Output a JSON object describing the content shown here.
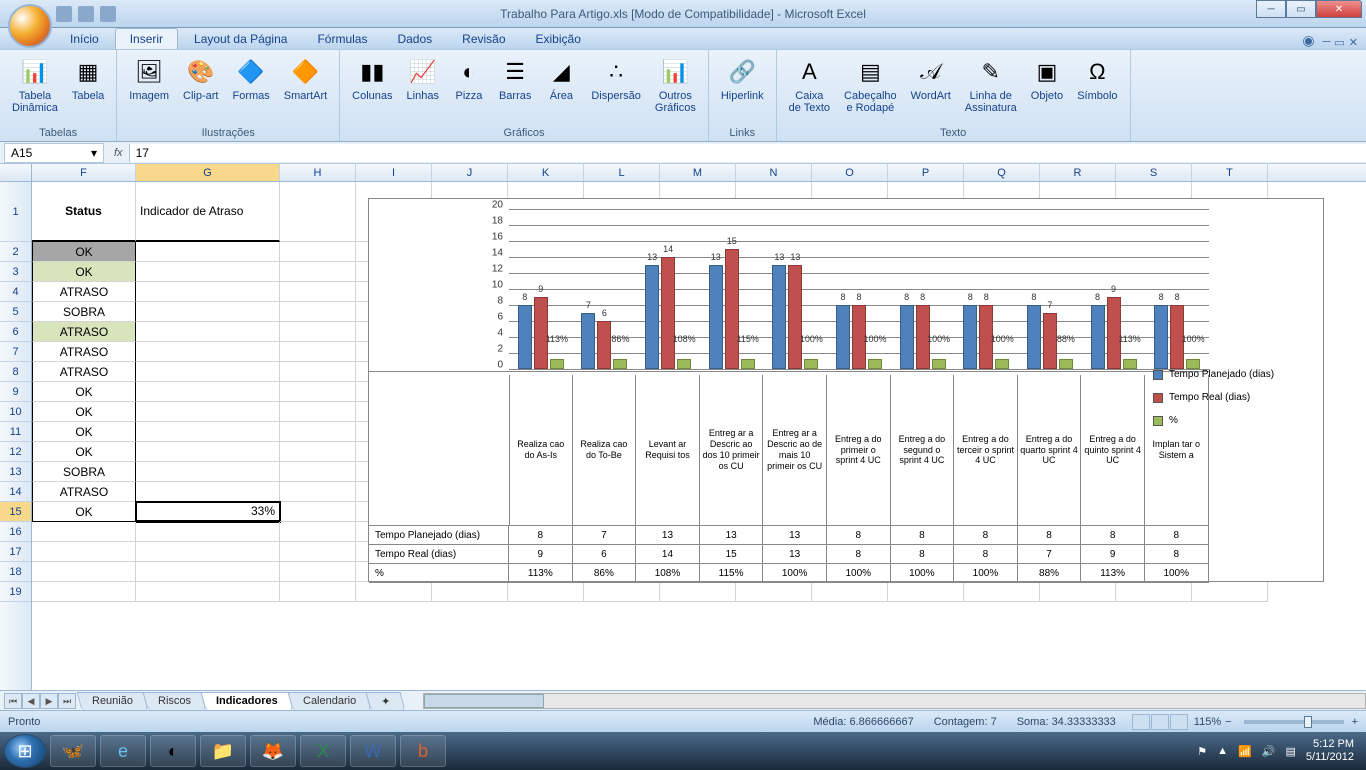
{
  "window": {
    "title": "Trabalho Para Artigo.xls  [Modo de Compatibilidade] - Microsoft Excel"
  },
  "tabs": {
    "items": [
      "Início",
      "Inserir",
      "Layout da Página",
      "Fórmulas",
      "Dados",
      "Revisão",
      "Exibição"
    ],
    "active": 1
  },
  "ribbon": {
    "groups": [
      {
        "title": "Tabelas",
        "items": [
          {
            "label": "Tabela\nDinâmica",
            "icon": "📊"
          },
          {
            "label": "Tabela",
            "icon": "▦"
          }
        ]
      },
      {
        "title": "Ilustrações",
        "items": [
          {
            "label": "Imagem",
            "icon": "🖼"
          },
          {
            "label": "Clip-art",
            "icon": "🎨"
          },
          {
            "label": "Formas",
            "icon": "🔷"
          },
          {
            "label": "SmartArt",
            "icon": "🔶"
          }
        ]
      },
      {
        "title": "Gráficos",
        "items": [
          {
            "label": "Colunas",
            "icon": "▮▮"
          },
          {
            "label": "Linhas",
            "icon": "📈"
          },
          {
            "label": "Pizza",
            "icon": "◐"
          },
          {
            "label": "Barras",
            "icon": "☰"
          },
          {
            "label": "Área",
            "icon": "◢"
          },
          {
            "label": "Dispersão",
            "icon": "∴"
          },
          {
            "label": "Outros\nGráficos",
            "icon": "📊"
          }
        ]
      },
      {
        "title": "Links",
        "items": [
          {
            "label": "Hiperlink",
            "icon": "🔗"
          }
        ]
      },
      {
        "title": "Texto",
        "items": [
          {
            "label": "Caixa\nde Texto",
            "icon": "A"
          },
          {
            "label": "Cabeçalho\ne Rodapé",
            "icon": "▤"
          },
          {
            "label": "WordArt",
            "icon": "𝒜"
          },
          {
            "label": "Linha de\nAssinatura",
            "icon": "✎"
          },
          {
            "label": "Objeto",
            "icon": "▣"
          },
          {
            "label": "Símbolo",
            "icon": "Ω"
          }
        ]
      }
    ]
  },
  "formula_bar": {
    "name_box": "A15",
    "formula": "17"
  },
  "columns": [
    "F",
    "G",
    "H",
    "I",
    "J",
    "K",
    "L",
    "M",
    "N",
    "O",
    "P",
    "Q",
    "R",
    "S",
    "T"
  ],
  "table": {
    "header": {
      "F": "Status",
      "G": "Indicador de Atraso"
    },
    "rows": [
      {
        "F": "OK",
        "class": "grey"
      },
      {
        "F": "OK",
        "class": "lightgreen"
      },
      {
        "F": "ATRASO",
        "class": ""
      },
      {
        "F": "SOBRA",
        "class": ""
      },
      {
        "F": "ATRASO",
        "class": "lightgreen"
      },
      {
        "F": "ATRASO",
        "class": ""
      },
      {
        "F": "ATRASO",
        "class": ""
      },
      {
        "F": "OK",
        "class": ""
      },
      {
        "F": "OK",
        "class": ""
      },
      {
        "F": "OK",
        "class": ""
      },
      {
        "F": "OK",
        "class": ""
      },
      {
        "F": "SOBRA",
        "class": ""
      },
      {
        "F": "ATRASO",
        "class": ""
      },
      {
        "F": "OK",
        "G": "33%",
        "class": ""
      }
    ]
  },
  "chart_data": {
    "type": "bar",
    "categories": [
      "Realiza cao do As-Is",
      "Realiza cao do To-Be",
      "Levant ar Requisi tos",
      "Entreg ar a Descric ao dos 10 primeir os CU",
      "Entreg ar a Descric ao de mais 10 primeir os CU",
      "Entreg a do primeir o sprint 4 UC",
      "Entreg a do segund o sprint 4 UC",
      "Entreg a do terceir o sprint 4 UC",
      "Entreg a do quarto sprint 4 UC",
      "Entreg a do quinto sprint 4 UC",
      "Implan tar o Sistem a"
    ],
    "series": [
      {
        "name": "Tempo Planejado (dias)",
        "color": "#4f81bd",
        "values": [
          8,
          7,
          13,
          13,
          13,
          8,
          8,
          8,
          8,
          8,
          8
        ]
      },
      {
        "name": "Tempo Real (dias)",
        "color": "#c0504d",
        "values": [
          9,
          6,
          14,
          15,
          13,
          8,
          8,
          8,
          7,
          9,
          8
        ]
      },
      {
        "name": "%",
        "color": "#9bbb59",
        "values_pct": [
          "113%",
          "86%",
          "108%",
          "115%",
          "100%",
          "100%",
          "100%",
          "100%",
          "88%",
          "113%",
          "100%"
        ]
      }
    ],
    "ylim": [
      0,
      20
    ],
    "yticks": [
      0,
      2,
      4,
      6,
      8,
      10,
      12,
      14,
      16,
      18,
      20
    ]
  },
  "sheet_tabs": {
    "items": [
      "Reunião",
      "Riscos",
      "Indicadores",
      "Calendario"
    ],
    "active": 2
  },
  "status_bar": {
    "ready": "Pronto",
    "avg_label": "Média:",
    "avg": "6.866666667",
    "count_label": "Contagem:",
    "count": "7",
    "sum_label": "Soma:",
    "sum": "34.33333333",
    "zoom": "115%"
  },
  "taskbar": {
    "time": "5:12 PM",
    "date": "5/11/2012"
  }
}
